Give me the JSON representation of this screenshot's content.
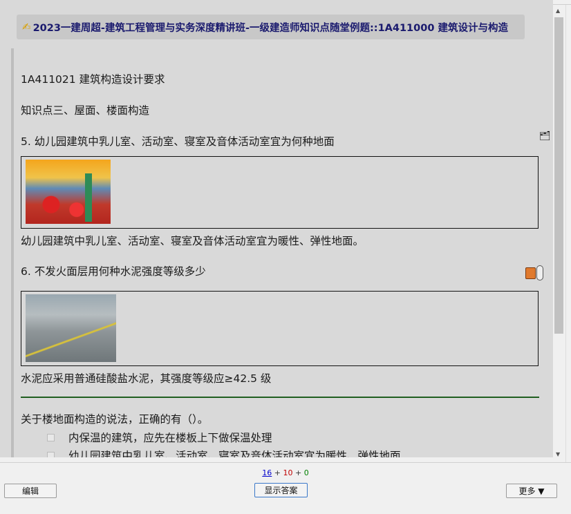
{
  "deck_title": "2023一建周超-建筑工程管理与实务深度精讲班-一级建造师知识点随堂例题::1A411000 建筑设计与构造",
  "icons": {
    "title": "pencil-icon",
    "card1": "cards-icon",
    "card2": "note-icon"
  },
  "card": {
    "section": "1A411021 建筑构造设计要求",
    "topic": "知识点三、屋面、楼面构造",
    "q5": "5. 幼儿园建筑中乳儿室、活动室、寝室及音体活动室宜为何种地面",
    "a5": "幼儿园建筑中乳儿室、活动室、寝室及音体活动室宜为暖性、弹性地面。",
    "q6": "6. 不发火面层用何种水泥强度等级多少",
    "a6": "水泥应采用普通硅酸盐水泥，其强度等级应≥42.5 级",
    "question": "关于楼地面构造的说法，正确的有（）。",
    "options": [
      "内保温的建筑，应先在楼板上下做保温处理",
      "幼儿园建筑中乳儿室、活动室、寝室及音体活动室宜为暖性、弹性地面"
    ]
  },
  "counts": {
    "new": "16",
    "learning": "10",
    "review": "0",
    "sep": "+"
  },
  "buttons": {
    "edit": "编辑",
    "show_answer": "显示答案",
    "more": "更多 ▼"
  },
  "colors": {
    "title_text": "#1a1a6e",
    "rule": "#1f5e1f",
    "new": "#0000cc",
    "learning": "#c00000",
    "review": "#008000"
  }
}
